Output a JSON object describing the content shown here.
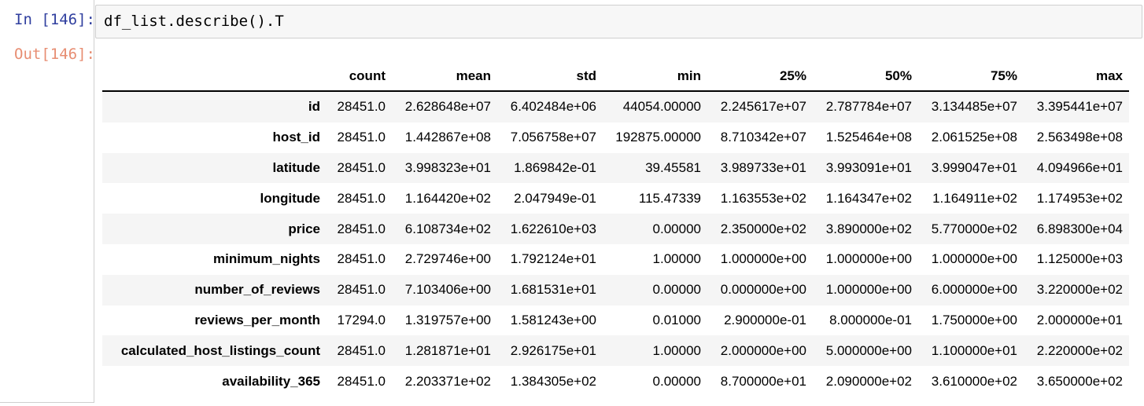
{
  "cell": {
    "in_prompt": "In [146]:",
    "out_prompt": "Out[146]:",
    "code": "df_list.describe().T"
  },
  "table": {
    "columns": [
      "count",
      "mean",
      "std",
      "min",
      "25%",
      "50%",
      "75%",
      "max"
    ],
    "rows": [
      {
        "index": "id",
        "values": [
          "28451.0",
          "2.628648e+07",
          "6.402484e+06",
          "44054.00000",
          "2.245617e+07",
          "2.787784e+07",
          "3.134485e+07",
          "3.395441e+07"
        ]
      },
      {
        "index": "host_id",
        "values": [
          "28451.0",
          "1.442867e+08",
          "7.056758e+07",
          "192875.00000",
          "8.710342e+07",
          "1.525464e+08",
          "2.061525e+08",
          "2.563498e+08"
        ]
      },
      {
        "index": "latitude",
        "values": [
          "28451.0",
          "3.998323e+01",
          "1.869842e-01",
          "39.45581",
          "3.989733e+01",
          "3.993091e+01",
          "3.999047e+01",
          "4.094966e+01"
        ]
      },
      {
        "index": "longitude",
        "values": [
          "28451.0",
          "1.164420e+02",
          "2.047949e-01",
          "115.47339",
          "1.163553e+02",
          "1.164347e+02",
          "1.164911e+02",
          "1.174953e+02"
        ]
      },
      {
        "index": "price",
        "values": [
          "28451.0",
          "6.108734e+02",
          "1.622610e+03",
          "0.00000",
          "2.350000e+02",
          "3.890000e+02",
          "5.770000e+02",
          "6.898300e+04"
        ]
      },
      {
        "index": "minimum_nights",
        "values": [
          "28451.0",
          "2.729746e+00",
          "1.792124e+01",
          "1.00000",
          "1.000000e+00",
          "1.000000e+00",
          "1.000000e+00",
          "1.125000e+03"
        ]
      },
      {
        "index": "number_of_reviews",
        "values": [
          "28451.0",
          "7.103406e+00",
          "1.681531e+01",
          "0.00000",
          "0.000000e+00",
          "1.000000e+00",
          "6.000000e+00",
          "3.220000e+02"
        ]
      },
      {
        "index": "reviews_per_month",
        "values": [
          "17294.0",
          "1.319757e+00",
          "1.581243e+00",
          "0.01000",
          "2.900000e-01",
          "8.000000e-01",
          "1.750000e+00",
          "2.000000e+01"
        ]
      },
      {
        "index": "calculated_host_listings_count",
        "values": [
          "28451.0",
          "1.281871e+01",
          "2.926175e+01",
          "1.00000",
          "2.000000e+00",
          "5.000000e+00",
          "1.100000e+01",
          "2.220000e+02"
        ]
      },
      {
        "index": "availability_365",
        "values": [
          "28451.0",
          "2.203371e+02",
          "1.384305e+02",
          "0.00000",
          "8.700000e+01",
          "2.090000e+02",
          "3.610000e+02",
          "3.650000e+02"
        ]
      }
    ]
  }
}
